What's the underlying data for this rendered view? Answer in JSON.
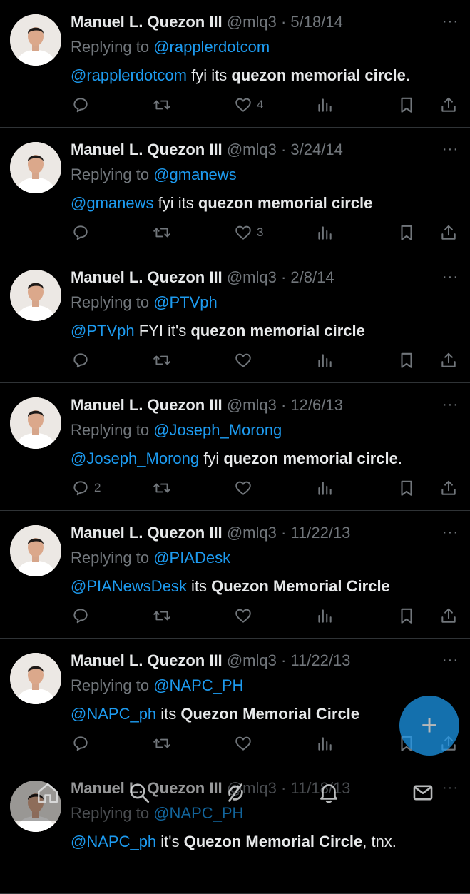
{
  "colors": {
    "background": "#000000",
    "text": "#e7e9ea",
    "muted": "#71767b",
    "link": "#1d9bf0",
    "divider": "#2f3336"
  },
  "tweets": [
    {
      "name": "Manuel L. Quezon III",
      "handle": "@mlq3",
      "sep": " · ",
      "date": "5/18/14",
      "replying_label": "Replying to ",
      "replying_to": "@rapplerdotcom",
      "mention": "@rapplerdotcom",
      "text_pre": " fyi its ",
      "text_bold": "quezon memorial circle",
      "text_post": ".",
      "replies": "",
      "retweets": "",
      "likes": "4"
    },
    {
      "name": "Manuel L. Quezon III",
      "handle": "@mlq3",
      "sep": " · ",
      "date": "3/24/14",
      "replying_label": "Replying to ",
      "replying_to": "@gmanews",
      "mention": "@gmanews",
      "text_pre": " fyi its ",
      "text_bold": "quezon memorial circle",
      "text_post": "",
      "replies": "",
      "retweets": "",
      "likes": "3"
    },
    {
      "name": "Manuel L. Quezon III",
      "handle": "@mlq3",
      "sep": " · ",
      "date": "2/8/14",
      "replying_label": "Replying to ",
      "replying_to": "@PTVph",
      "mention": "@PTVph",
      "text_pre": " FYI it's ",
      "text_bold": "quezon memorial circle",
      "text_post": "",
      "replies": "",
      "retweets": "",
      "likes": ""
    },
    {
      "name": "Manuel L. Quezon III",
      "handle": "@mlq3",
      "sep": " · ",
      "date": "12/6/13",
      "replying_label": "Replying to ",
      "replying_to": "@Joseph_Morong",
      "mention": "@Joseph_Morong",
      "text_pre": " fyi ",
      "text_bold": "quezon memorial circle",
      "text_post": ".",
      "replies": "2",
      "retweets": "",
      "likes": ""
    },
    {
      "name": "Manuel L. Quezon III",
      "handle": "@mlq3",
      "sep": " · ",
      "date": "11/22/13",
      "replying_label": "Replying to ",
      "replying_to": "@PIADesk",
      "mention": "@PIANewsDesk",
      "text_pre": " its ",
      "text_bold": "Quezon Memorial Circle",
      "text_post": "",
      "replies": "",
      "retweets": "",
      "likes": ""
    },
    {
      "name": "Manuel L. Quezon III",
      "handle": "@mlq3",
      "sep": " · ",
      "date": "11/22/13",
      "replying_label": "Replying to ",
      "replying_to": "@NAPC_PH",
      "mention": "@NAPC_ph",
      "text_pre": " its ",
      "text_bold": "Quezon Memorial Circle",
      "text_post": "",
      "replies": "",
      "retweets": "",
      "likes": ""
    },
    {
      "name": "Manuel L. Quezon III",
      "handle": "@mlq3",
      "sep": " · ",
      "date": "11/18/13",
      "replying_label": "Replying to ",
      "replying_to": "@NAPC_PH",
      "mention": "@NAPC_ph",
      "text_pre": " it's ",
      "text_bold": "Quezon Memorial Circle",
      "text_post": ", tnx.",
      "replies": "",
      "retweets": "",
      "likes": ""
    }
  ],
  "more_glyph": "···",
  "fab": {
    "label": "+",
    "icon": "compose-plus-icon"
  },
  "navbar": {
    "items": [
      {
        "icon": "home-icon"
      },
      {
        "icon": "search-icon"
      },
      {
        "icon": "grok-icon"
      },
      {
        "icon": "bell-icon"
      },
      {
        "icon": "mail-icon"
      }
    ]
  }
}
